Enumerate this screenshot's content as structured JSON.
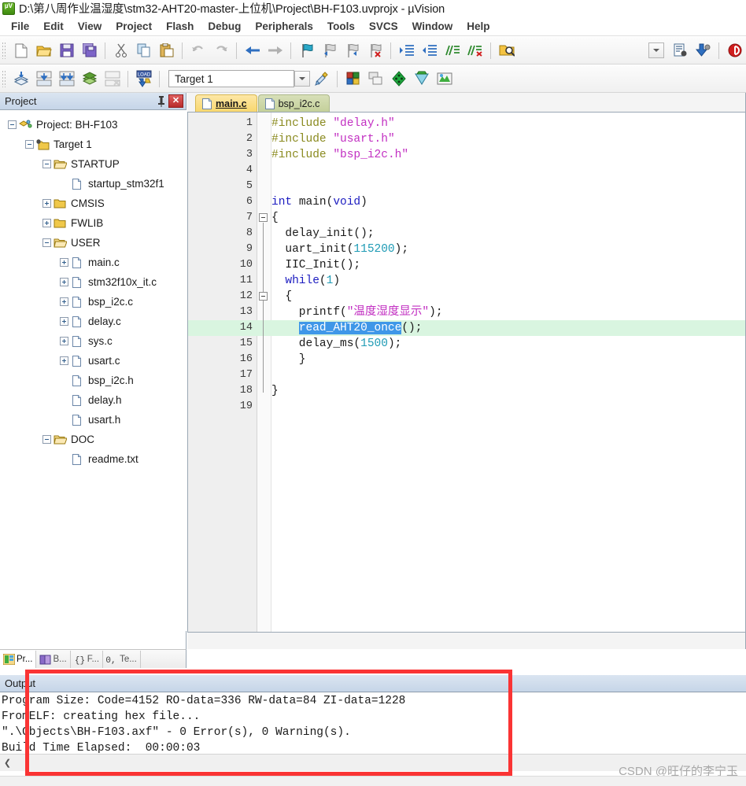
{
  "window": {
    "title": "D:\\第八周作业温湿度\\stm32-AHT20-master-上位机\\Project\\BH-F103.uvprojx - µVision",
    "app_icon": "uvision-icon"
  },
  "menubar": {
    "items": [
      {
        "label": "File"
      },
      {
        "label": "Edit"
      },
      {
        "label": "View"
      },
      {
        "label": "Project"
      },
      {
        "label": "Flash"
      },
      {
        "label": "Debug"
      },
      {
        "label": "Peripherals"
      },
      {
        "label": "Tools"
      },
      {
        "label": "SVCS"
      },
      {
        "label": "Window"
      },
      {
        "label": "Help"
      }
    ]
  },
  "toolbar_file": {
    "buttons": [
      {
        "name": "new-file-icon"
      },
      {
        "name": "open-file-icon"
      },
      {
        "name": "save-icon"
      },
      {
        "name": "save-all-icon"
      },
      {
        "name": "cut-icon"
      },
      {
        "name": "copy-icon"
      },
      {
        "name": "paste-icon"
      },
      {
        "name": "undo-icon"
      },
      {
        "name": "redo-icon"
      },
      {
        "name": "navigate-back-icon"
      },
      {
        "name": "navigate-forward-icon"
      },
      {
        "name": "bookmark-toggle-icon"
      },
      {
        "name": "bookmark-prev-icon"
      },
      {
        "name": "bookmark-next-icon"
      },
      {
        "name": "bookmark-clear-icon"
      },
      {
        "name": "indent-right-icon"
      },
      {
        "name": "indent-left-icon"
      },
      {
        "name": "comment-lines-icon"
      },
      {
        "name": "uncomment-lines-icon"
      },
      {
        "name": "find-in-files-icon"
      },
      {
        "name": "debug-session-icon"
      },
      {
        "name": "configuration-wizard-icon"
      },
      {
        "name": "download-icon"
      },
      {
        "name": "debug-start-icon"
      }
    ]
  },
  "toolbar_build": {
    "buttons": [
      {
        "name": "translate-icon"
      },
      {
        "name": "build-icon"
      },
      {
        "name": "rebuild-all-icon"
      },
      {
        "name": "batch-build-icon"
      },
      {
        "name": "stop-build-icon"
      },
      {
        "name": "download-to-flash-icon"
      },
      {
        "name": "target-options-icon"
      },
      {
        "name": "manage-project-items-icon"
      },
      {
        "name": "multi-project-icon"
      },
      {
        "name": "pack-installer-icon"
      },
      {
        "name": "manage-run-time-env-icon"
      },
      {
        "name": "svn-icon"
      }
    ],
    "target_select": {
      "value": "Target 1",
      "name": "target-combo"
    }
  },
  "project_panel": {
    "title": "Project",
    "pin_icon": "pin-icon",
    "close_icon": "close-icon",
    "tree": [
      {
        "label": "Project: BH-F103",
        "depth": 0,
        "expander": "minus",
        "icon": "project-icon"
      },
      {
        "label": "Target 1",
        "depth": 1,
        "expander": "minus",
        "icon": "target-icon"
      },
      {
        "label": "STARTUP",
        "depth": 2,
        "expander": "minus",
        "icon": "folder-open-icon"
      },
      {
        "label": "startup_stm32f1",
        "depth": 3,
        "expander": "none",
        "icon": "file-icon"
      },
      {
        "label": "CMSIS",
        "depth": 2,
        "expander": "plus",
        "icon": "folder-closed-icon"
      },
      {
        "label": "FWLIB",
        "depth": 2,
        "expander": "plus",
        "icon": "folder-closed-icon"
      },
      {
        "label": "USER",
        "depth": 2,
        "expander": "minus",
        "icon": "folder-open-icon"
      },
      {
        "label": "main.c",
        "depth": 3,
        "expander": "plus",
        "icon": "c-file-icon"
      },
      {
        "label": "stm32f10x_it.c",
        "depth": 3,
        "expander": "plus",
        "icon": "c-file-icon"
      },
      {
        "label": "bsp_i2c.c",
        "depth": 3,
        "expander": "plus",
        "icon": "c-file-icon"
      },
      {
        "label": "delay.c",
        "depth": 3,
        "expander": "plus",
        "icon": "c-file-icon"
      },
      {
        "label": "sys.c",
        "depth": 3,
        "expander": "plus",
        "icon": "c-file-icon"
      },
      {
        "label": "usart.c",
        "depth": 3,
        "expander": "plus",
        "icon": "c-file-icon"
      },
      {
        "label": "bsp_i2c.h",
        "depth": 3,
        "expander": "none",
        "icon": "h-file-icon"
      },
      {
        "label": "delay.h",
        "depth": 3,
        "expander": "none",
        "icon": "h-file-icon"
      },
      {
        "label": "usart.h",
        "depth": 3,
        "expander": "none",
        "icon": "h-file-icon"
      },
      {
        "label": "DOC",
        "depth": 2,
        "expander": "minus",
        "icon": "folder-open-icon"
      },
      {
        "label": "readme.txt",
        "depth": 3,
        "expander": "none",
        "icon": "txt-file-icon"
      }
    ],
    "bottom_tabs": [
      {
        "label": "Pr...",
        "icon": "project-view-icon",
        "active": true
      },
      {
        "label": "B...",
        "icon": "books-view-icon",
        "active": false
      },
      {
        "label": "F...",
        "icon": "functions-view-icon",
        "active": false
      },
      {
        "label": "Te...",
        "icon": "templates-view-icon",
        "active": false
      }
    ]
  },
  "editor": {
    "tabs": [
      {
        "label": "main.c",
        "icon": "c-file-icon",
        "active": true
      },
      {
        "label": "bsp_i2c.c",
        "icon": "c-file-icon",
        "active": false
      }
    ],
    "lines": [
      {
        "n": "1",
        "segments": [
          {
            "t": "#include ",
            "c": "pre"
          },
          {
            "t": "\"delay.h\"",
            "c": "str"
          }
        ]
      },
      {
        "n": "2",
        "segments": [
          {
            "t": "#include ",
            "c": "pre"
          },
          {
            "t": "\"usart.h\"",
            "c": "str"
          }
        ]
      },
      {
        "n": "3",
        "segments": [
          {
            "t": "#include ",
            "c": "pre"
          },
          {
            "t": "\"bsp_i2c.h\"",
            "c": "str"
          }
        ]
      },
      {
        "n": "4",
        "segments": []
      },
      {
        "n": "5",
        "segments": []
      },
      {
        "n": "6",
        "segments": [
          {
            "t": "int ",
            "c": "kw"
          },
          {
            "t": "main(",
            "c": "def"
          },
          {
            "t": "void",
            "c": "kw"
          },
          {
            "t": ")",
            "c": "def"
          }
        ]
      },
      {
        "n": "7",
        "segments": [
          {
            "t": "{",
            "c": "def"
          }
        ]
      },
      {
        "n": "8",
        "segments": [
          {
            "t": "  delay_init();",
            "c": "def"
          }
        ]
      },
      {
        "n": "9",
        "segments": [
          {
            "t": "  uart_init(",
            "c": "def"
          },
          {
            "t": "115200",
            "c": "num"
          },
          {
            "t": ");",
            "c": "def"
          }
        ]
      },
      {
        "n": "10",
        "segments": [
          {
            "t": "  IIC_Init();",
            "c": "def"
          }
        ]
      },
      {
        "n": "11",
        "segments": [
          {
            "t": "  ",
            "c": "def"
          },
          {
            "t": "while",
            "c": "kw"
          },
          {
            "t": "(",
            "c": "def"
          },
          {
            "t": "1",
            "c": "num"
          },
          {
            "t": ")",
            "c": "def"
          }
        ]
      },
      {
        "n": "12",
        "segments": [
          {
            "t": "  {",
            "c": "def"
          }
        ]
      },
      {
        "n": "13",
        "segments": [
          {
            "t": "    printf(",
            "c": "def"
          },
          {
            "t": "\"温度湿度显示\"",
            "c": "str"
          },
          {
            "t": ");",
            "c": "def"
          }
        ]
      },
      {
        "n": "14",
        "segments": [
          {
            "t": "    ",
            "c": "def"
          },
          {
            "t": "read_AHT20_once",
            "c": "sel"
          },
          {
            "t": "();",
            "c": "def"
          }
        ],
        "highlight": true
      },
      {
        "n": "15",
        "segments": [
          {
            "t": "    delay_ms(",
            "c": "def"
          },
          {
            "t": "1500",
            "c": "num"
          },
          {
            "t": ");",
            "c": "def"
          }
        ]
      },
      {
        "n": "16",
        "segments": [
          {
            "t": "    }",
            "c": "def"
          }
        ]
      },
      {
        "n": "17",
        "segments": []
      },
      {
        "n": "18",
        "segments": [
          {
            "t": "}",
            "c": "def"
          }
        ]
      },
      {
        "n": "19",
        "segments": []
      }
    ]
  },
  "output_panel": {
    "title": "Output",
    "lines": [
      "Program Size: Code=4152 RO-data=336 RW-data=84 ZI-data=1228",
      "FromELF: creating hex file...",
      "\".\\Objects\\BH-F103.axf\" - 0 Error(s), 0 Warning(s).",
      "Build Time Elapsed:  00:00:03"
    ]
  },
  "annotation": {
    "color": "#fa3434",
    "shape": "rectangle"
  },
  "watermark": {
    "text": "CSDN @旺仔的李宁玉"
  },
  "colors": {
    "accent": "#f8d76e",
    "panel_header": "#c6d5e8",
    "highlight_line": "#d9f5e0",
    "selection": "#3f97e8",
    "annotation_red": "#fa3434"
  }
}
